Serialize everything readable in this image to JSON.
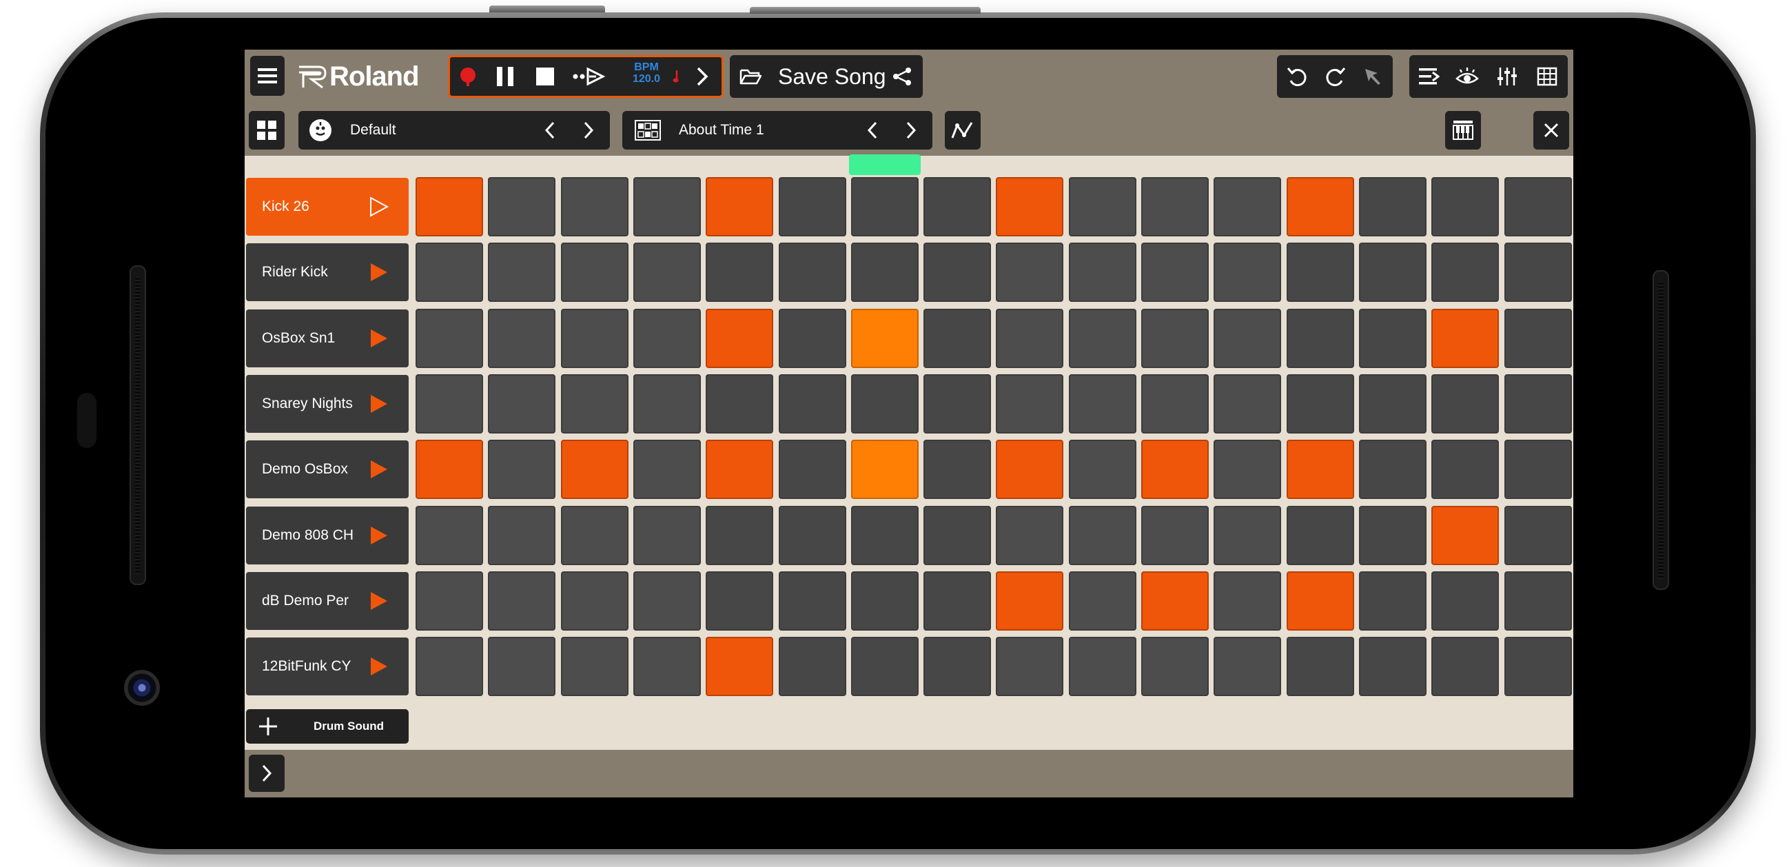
{
  "colors": {
    "accent": "#ef560a",
    "step_current": "#ff7f05",
    "step_off": "#4d4d4d",
    "playhead": "#40f095",
    "bar": "#877d6e",
    "background": "#e7dfd2",
    "bpm_text": "#2f87e0"
  },
  "header": {
    "menu_icon": "hamburger-menu-icon",
    "logo_text": "Roland",
    "transport": {
      "record_icon": "record-icon",
      "pause_icon": "pause-icon",
      "stop_icon": "stop-icon",
      "loop_icon": "loop-play-icon",
      "bpm_label": "BPM",
      "bpm_value": "120.0",
      "metronome_icon": "metronome-icon",
      "next_icon": "chevron-right-icon"
    },
    "save_song_label": "Save Song",
    "folder_icon": "folder-open-icon",
    "share_icon": "share-icon",
    "tools": [
      "undo-icon",
      "redo-icon",
      "pointer-icon",
      "tracks-icon",
      "view-icon",
      "mixer-icon",
      "grid-icon"
    ]
  },
  "subbar": {
    "kit_name": "Default",
    "pattern_name": "About Time 1",
    "automation_icon": "automation-curve-icon",
    "piano_roll_icon": "piano-roll-icon",
    "close_icon": "close-icon"
  },
  "sequencer": {
    "steps": 16,
    "current_step": 7,
    "tracks": [
      {
        "name": "Kick 26",
        "selected": true,
        "steps": [
          1,
          5,
          9,
          13
        ]
      },
      {
        "name": "Rider Kick",
        "selected": false,
        "steps": []
      },
      {
        "name": "OsBox Sn1",
        "selected": false,
        "steps": [
          5,
          7,
          15
        ]
      },
      {
        "name": "Snarey Nights",
        "selected": false,
        "steps": []
      },
      {
        "name": "Demo OsBox",
        "selected": false,
        "steps": [
          1,
          3,
          5,
          7,
          9,
          11,
          13
        ]
      },
      {
        "name": "Demo 808 CH",
        "selected": false,
        "steps": [
          15
        ]
      },
      {
        "name": "dB Demo Per",
        "selected": false,
        "steps": [
          9,
          11,
          13
        ]
      },
      {
        "name": "12BitFunk CY",
        "selected": false,
        "steps": [
          5
        ]
      }
    ]
  },
  "add_drum_sound_label": "Drum Sound",
  "footer": {
    "expand_icon": "chevron-right-icon"
  }
}
